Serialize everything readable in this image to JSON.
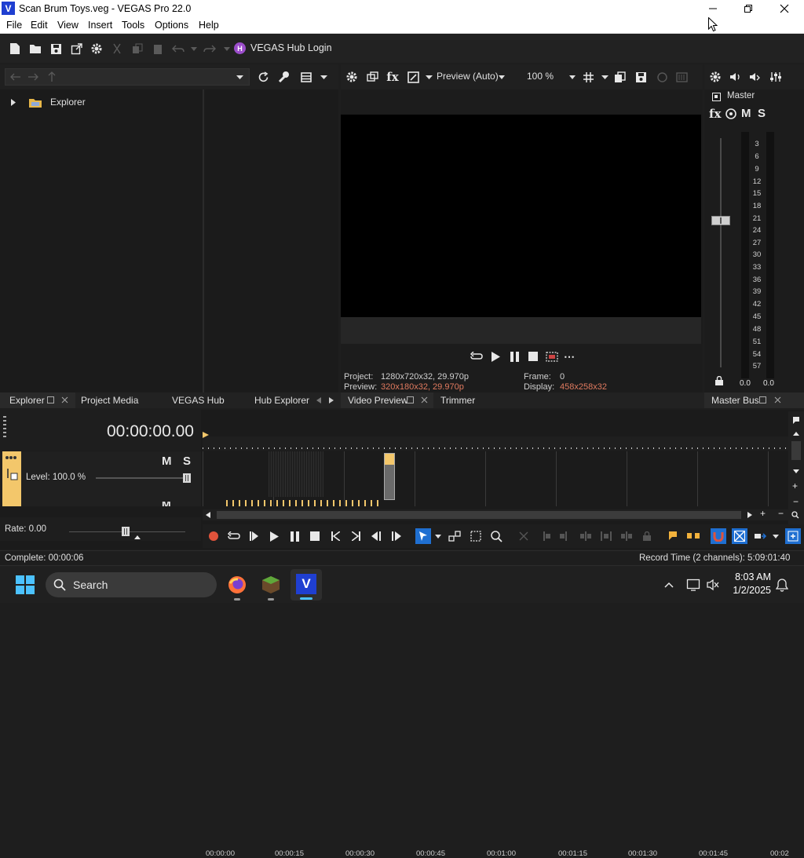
{
  "window": {
    "title": "Scan Brum Toys.veg - VEGAS Pro 22.0",
    "app_icon_letter": "V"
  },
  "menu": {
    "items": [
      "File",
      "Edit",
      "View",
      "Insert",
      "Tools",
      "Options",
      "Help"
    ]
  },
  "toolbar": {
    "hub_login_label": "VEGAS Hub Login",
    "hub_icon_letter": "H"
  },
  "explorer": {
    "tree_root": "Explorer"
  },
  "preview_toolbar": {
    "quality_label": "Preview (Auto)",
    "zoom_label": "100 %"
  },
  "preview_info": {
    "project_label": "Project:",
    "project_value": "1280x720x32, 29.970p",
    "preview_label": "Preview:",
    "preview_value": "320x180x32, 29.970p",
    "frame_label": "Frame:",
    "frame_value": "0",
    "display_label": "Display:",
    "display_value": "458x258x32",
    "preview_value_color": "#e07a5f"
  },
  "master": {
    "label": "Master",
    "fx_label": "fx",
    "m_label": "M",
    "s_label": "S",
    "scale": [
      "3",
      "6",
      "9",
      "12",
      "15",
      "18",
      "21",
      "24",
      "27",
      "30",
      "33",
      "36",
      "39",
      "42",
      "45",
      "48",
      "51",
      "54",
      "57"
    ],
    "left_peak": "0.0",
    "right_peak": "0.0"
  },
  "tabs": {
    "left": [
      "Explorer",
      "Project Media",
      "VEGAS Hub",
      "Hub Explorer"
    ],
    "middle": [
      "Video Preview",
      "Trimmer"
    ],
    "right": [
      "Master Bus"
    ]
  },
  "timeline": {
    "timecode": "00:00:00.00",
    "track_m": "M",
    "track_s": "S",
    "track_level": "Level: 100.0 %",
    "rate": "Rate: 0.00",
    "ruler": [
      "00:00:00",
      "00:00:15",
      "00:00:30",
      "00:00:45",
      "00:01:00",
      "00:01:15",
      "00:01:30",
      "00:01:45",
      "00:02"
    ]
  },
  "status": {
    "complete": "Complete: 00:00:06",
    "record_time": "Record Time (2 channels): 5:09:01:40"
  },
  "taskbar": {
    "search_placeholder": "Search",
    "time": "8:03 AM",
    "date": "1/2/2025"
  },
  "colors": {
    "accent_blue": "#1f6fd1",
    "track_yellow": "#f3c76b",
    "hub_purple": "#9b4dca"
  }
}
